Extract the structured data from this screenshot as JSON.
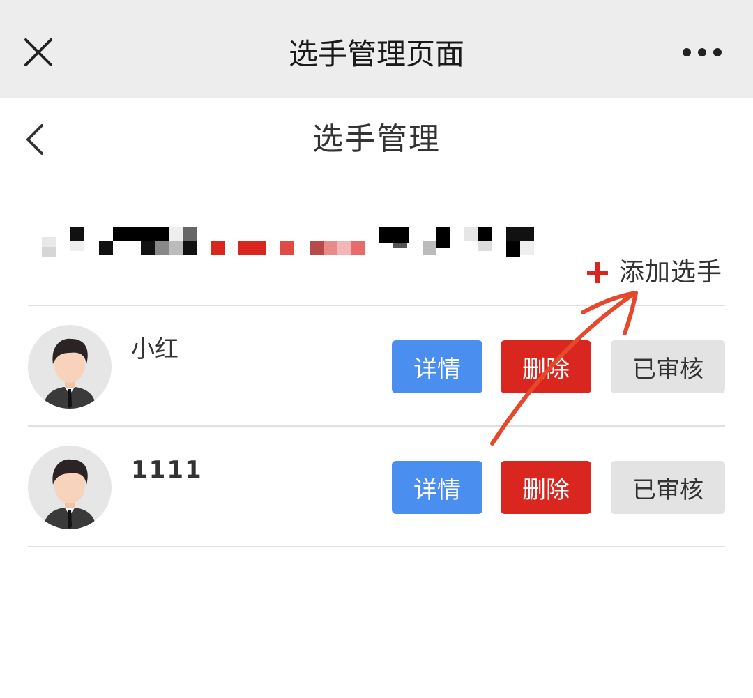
{
  "window": {
    "title": "选手管理页面",
    "close_icon": "close-icon",
    "more_icon": "more-icon"
  },
  "header": {
    "title": "选手管理",
    "back_icon": "chevron-left-icon"
  },
  "toolbar": {
    "add_label": "添加选手",
    "add_icon": "plus-icon",
    "accent": "#d9271f"
  },
  "players": [
    {
      "name": "小红",
      "detail_label": "详情",
      "delete_label": "删除",
      "status_label": "已审核"
    },
    {
      "name": "1111",
      "detail_label": "详情",
      "delete_label": "删除",
      "status_label": "已审核"
    }
  ],
  "colors": {
    "detail": "#4a8ef0",
    "delete": "#d9271f",
    "status": "#e3e3e3",
    "topbar": "#ededed",
    "annotation_arrow": "#e5482a"
  }
}
